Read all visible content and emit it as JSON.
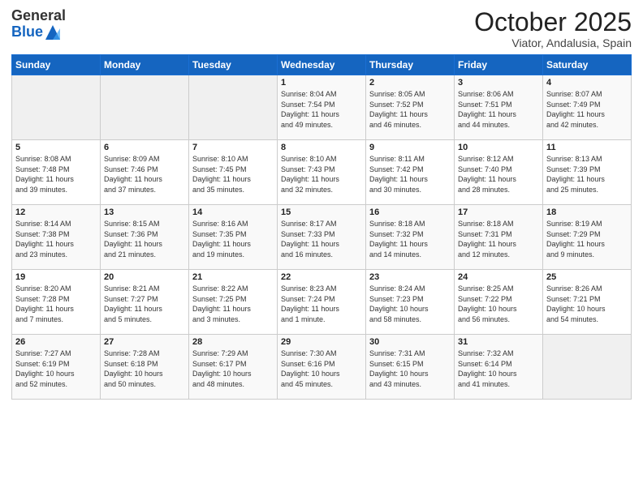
{
  "header": {
    "logo_general": "General",
    "logo_blue": "Blue",
    "month_title": "October 2025",
    "subtitle": "Viator, Andalusia, Spain"
  },
  "columns": [
    "Sunday",
    "Monday",
    "Tuesday",
    "Wednesday",
    "Thursday",
    "Friday",
    "Saturday"
  ],
  "weeks": [
    [
      {
        "day": "",
        "info": ""
      },
      {
        "day": "",
        "info": ""
      },
      {
        "day": "",
        "info": ""
      },
      {
        "day": "1",
        "info": "Sunrise: 8:04 AM\nSunset: 7:54 PM\nDaylight: 11 hours\nand 49 minutes."
      },
      {
        "day": "2",
        "info": "Sunrise: 8:05 AM\nSunset: 7:52 PM\nDaylight: 11 hours\nand 46 minutes."
      },
      {
        "day": "3",
        "info": "Sunrise: 8:06 AM\nSunset: 7:51 PM\nDaylight: 11 hours\nand 44 minutes."
      },
      {
        "day": "4",
        "info": "Sunrise: 8:07 AM\nSunset: 7:49 PM\nDaylight: 11 hours\nand 42 minutes."
      }
    ],
    [
      {
        "day": "5",
        "info": "Sunrise: 8:08 AM\nSunset: 7:48 PM\nDaylight: 11 hours\nand 39 minutes."
      },
      {
        "day": "6",
        "info": "Sunrise: 8:09 AM\nSunset: 7:46 PM\nDaylight: 11 hours\nand 37 minutes."
      },
      {
        "day": "7",
        "info": "Sunrise: 8:10 AM\nSunset: 7:45 PM\nDaylight: 11 hours\nand 35 minutes."
      },
      {
        "day": "8",
        "info": "Sunrise: 8:10 AM\nSunset: 7:43 PM\nDaylight: 11 hours\nand 32 minutes."
      },
      {
        "day": "9",
        "info": "Sunrise: 8:11 AM\nSunset: 7:42 PM\nDaylight: 11 hours\nand 30 minutes."
      },
      {
        "day": "10",
        "info": "Sunrise: 8:12 AM\nSunset: 7:40 PM\nDaylight: 11 hours\nand 28 minutes."
      },
      {
        "day": "11",
        "info": "Sunrise: 8:13 AM\nSunset: 7:39 PM\nDaylight: 11 hours\nand 25 minutes."
      }
    ],
    [
      {
        "day": "12",
        "info": "Sunrise: 8:14 AM\nSunset: 7:38 PM\nDaylight: 11 hours\nand 23 minutes."
      },
      {
        "day": "13",
        "info": "Sunrise: 8:15 AM\nSunset: 7:36 PM\nDaylight: 11 hours\nand 21 minutes."
      },
      {
        "day": "14",
        "info": "Sunrise: 8:16 AM\nSunset: 7:35 PM\nDaylight: 11 hours\nand 19 minutes."
      },
      {
        "day": "15",
        "info": "Sunrise: 8:17 AM\nSunset: 7:33 PM\nDaylight: 11 hours\nand 16 minutes."
      },
      {
        "day": "16",
        "info": "Sunrise: 8:18 AM\nSunset: 7:32 PM\nDaylight: 11 hours\nand 14 minutes."
      },
      {
        "day": "17",
        "info": "Sunrise: 8:18 AM\nSunset: 7:31 PM\nDaylight: 11 hours\nand 12 minutes."
      },
      {
        "day": "18",
        "info": "Sunrise: 8:19 AM\nSunset: 7:29 PM\nDaylight: 11 hours\nand 9 minutes."
      }
    ],
    [
      {
        "day": "19",
        "info": "Sunrise: 8:20 AM\nSunset: 7:28 PM\nDaylight: 11 hours\nand 7 minutes."
      },
      {
        "day": "20",
        "info": "Sunrise: 8:21 AM\nSunset: 7:27 PM\nDaylight: 11 hours\nand 5 minutes."
      },
      {
        "day": "21",
        "info": "Sunrise: 8:22 AM\nSunset: 7:25 PM\nDaylight: 11 hours\nand 3 minutes."
      },
      {
        "day": "22",
        "info": "Sunrise: 8:23 AM\nSunset: 7:24 PM\nDaylight: 11 hours\nand 1 minute."
      },
      {
        "day": "23",
        "info": "Sunrise: 8:24 AM\nSunset: 7:23 PM\nDaylight: 10 hours\nand 58 minutes."
      },
      {
        "day": "24",
        "info": "Sunrise: 8:25 AM\nSunset: 7:22 PM\nDaylight: 10 hours\nand 56 minutes."
      },
      {
        "day": "25",
        "info": "Sunrise: 8:26 AM\nSunset: 7:21 PM\nDaylight: 10 hours\nand 54 minutes."
      }
    ],
    [
      {
        "day": "26",
        "info": "Sunrise: 7:27 AM\nSunset: 6:19 PM\nDaylight: 10 hours\nand 52 minutes."
      },
      {
        "day": "27",
        "info": "Sunrise: 7:28 AM\nSunset: 6:18 PM\nDaylight: 10 hours\nand 50 minutes."
      },
      {
        "day": "28",
        "info": "Sunrise: 7:29 AM\nSunset: 6:17 PM\nDaylight: 10 hours\nand 48 minutes."
      },
      {
        "day": "29",
        "info": "Sunrise: 7:30 AM\nSunset: 6:16 PM\nDaylight: 10 hours\nand 45 minutes."
      },
      {
        "day": "30",
        "info": "Sunrise: 7:31 AM\nSunset: 6:15 PM\nDaylight: 10 hours\nand 43 minutes."
      },
      {
        "day": "31",
        "info": "Sunrise: 7:32 AM\nSunset: 6:14 PM\nDaylight: 10 hours\nand 41 minutes."
      },
      {
        "day": "",
        "info": ""
      }
    ]
  ]
}
